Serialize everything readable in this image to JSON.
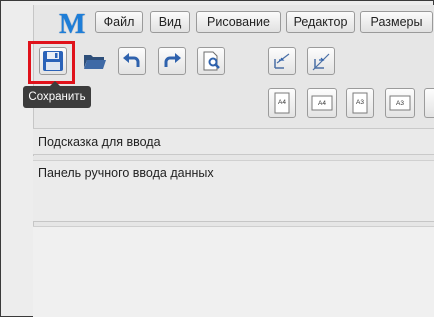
{
  "app": {
    "logo_letter": "M",
    "menu": [
      {
        "label": "Файл"
      },
      {
        "label": "Вид"
      },
      {
        "label": "Рисование"
      },
      {
        "label": "Редактор"
      },
      {
        "label": "Размеры"
      }
    ]
  },
  "toolbar": {
    "buttons": [
      {
        "icon": "save-icon"
      },
      {
        "icon": "open-folder-icon"
      },
      {
        "icon": "undo-icon"
      },
      {
        "icon": "redo-icon"
      },
      {
        "icon": "page-zoom-icon"
      },
      {
        "icon": "trim-icon"
      },
      {
        "icon": "extend-icon"
      }
    ],
    "paper_buttons": [
      {
        "label": "A4",
        "orientation": "portrait"
      },
      {
        "label": "A4",
        "orientation": "landscape"
      },
      {
        "label": "A3",
        "orientation": "portrait"
      },
      {
        "label": "A3",
        "orientation": "landscape"
      }
    ],
    "save_tooltip": "Сохранить"
  },
  "hint_panel": {
    "text": "Подсказка для ввода"
  },
  "input_panel": {
    "text": "Панель ручного ввода данных"
  },
  "colors": {
    "logo": "#1e7ed8",
    "highlight": "#e0121b",
    "tooltip_bg": "#3c3c3c",
    "save_icon": "#2a62b8",
    "arrow_icon": "#2f62ad"
  }
}
